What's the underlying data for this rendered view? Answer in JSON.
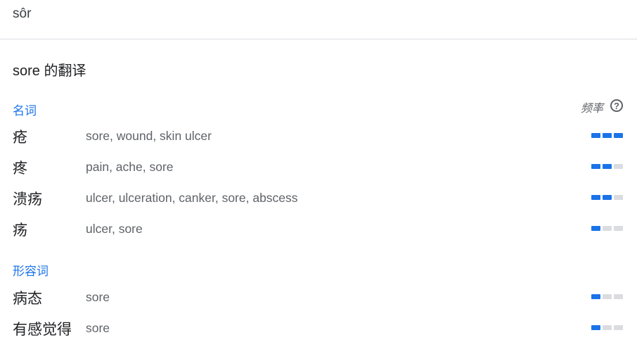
{
  "pronunciation": "sôr",
  "translations_title": "sore 的翻译",
  "frequency_label": "频率",
  "help_glyph": "?",
  "colors": {
    "accent": "#1a73e8",
    "meter_off": "#dadce0",
    "divider": "#dadce0"
  },
  "groups": [
    {
      "pos": "名词",
      "entries": [
        {
          "term": "疮",
          "synonyms": "sore, wound, skin ulcer",
          "frequency_bars": 3
        },
        {
          "term": "疼",
          "synonyms": "pain, ache, sore",
          "frequency_bars": 2
        },
        {
          "term": "溃疡",
          "synonyms": "ulcer, ulceration, canker, sore, abscess",
          "frequency_bars": 2
        },
        {
          "term": "疡",
          "synonyms": "ulcer, sore",
          "frequency_bars": 1
        }
      ]
    },
    {
      "pos": "形容词",
      "entries": [
        {
          "term": "病态",
          "synonyms": "sore",
          "frequency_bars": 1
        },
        {
          "term": "有感觉得",
          "synonyms": "sore",
          "frequency_bars": 1
        }
      ]
    }
  ]
}
